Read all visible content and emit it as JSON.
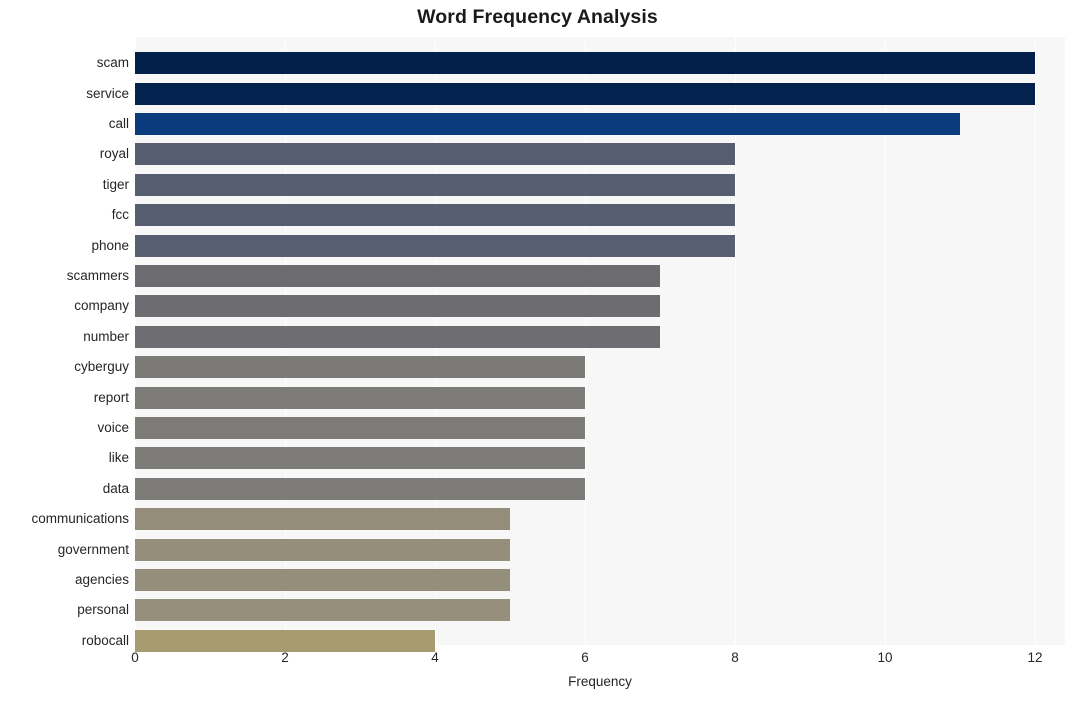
{
  "chart_data": {
    "type": "bar",
    "orientation": "horizontal",
    "title": "Word Frequency Analysis",
    "xlabel": "Frequency",
    "ylabel": "",
    "xlim": [
      0,
      12.4
    ],
    "xticks": [
      0,
      2,
      4,
      6,
      8,
      10,
      12
    ],
    "xtick_labels": [
      "0",
      "2",
      "4",
      "6",
      "8",
      "10",
      "12"
    ],
    "grid": "vertical-white",
    "legend": "none",
    "plot_background": "#f7f7f7",
    "figure_background": "#ffffff",
    "categories": [
      "scam",
      "service",
      "call",
      "royal",
      "tiger",
      "fcc",
      "phone",
      "scammers",
      "company",
      "number",
      "cyberguy",
      "report",
      "voice",
      "like",
      "data",
      "communications",
      "government",
      "agencies",
      "personal",
      "robocall"
    ],
    "values": [
      12,
      12,
      11,
      8,
      8,
      8,
      8,
      7,
      7,
      7,
      6,
      6,
      6,
      6,
      6,
      5,
      5,
      5,
      5,
      4
    ],
    "bar_colors": [
      "#03204a",
      "#03224d",
      "#0a3c7d",
      "#575d70",
      "#585e71",
      "#585e71",
      "#595f72",
      "#6c6c70",
      "#6d6d71",
      "#6e6e72",
      "#7b7a76",
      "#7c7b77",
      "#7c7b77",
      "#7d7c78",
      "#7d7c78",
      "#938d79",
      "#948e7a",
      "#948e7a",
      "#958f7b",
      "#a69c70"
    ]
  },
  "axis": {
    "x_title": "Frequency"
  }
}
